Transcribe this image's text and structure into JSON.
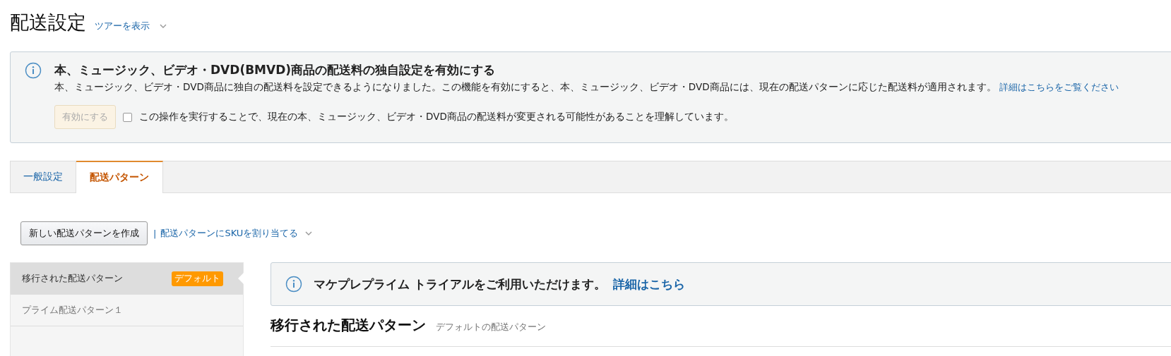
{
  "page": {
    "title": "配送設定",
    "tour_link": "ツアーを表示"
  },
  "notice": {
    "title": "本、ミュージック、ビデオ・DVD(BMVD)商品の配送料の独自設定を有効にする",
    "body": "本、ミュージック、ビデオ・DVD商品に独自の配送料を設定できるようになりました。この機能を有効にすると、本、ミュージック、ビデオ・DVD商品には、現在の配送パターンに応じた配送料が適用されます。",
    "link": "詳細はこちらをご覧ください",
    "button": {
      "label": "有効にする",
      "disabled": true
    },
    "consent": {
      "label": "この操作を実行することで、現在の本、ミュージック、ビデオ・DVD商品の配送料が変更される可能性があることを理解しています。",
      "checked": false
    }
  },
  "tabs": [
    {
      "label": "一般設定",
      "selected": false
    },
    {
      "label": "配送パターン",
      "selected": true
    }
  ],
  "toolbar": {
    "create_button": "新しい配送パターンを作成",
    "separator": "|",
    "assign_link": "配送パターンにSKUを割り当てる"
  },
  "patterns": [
    {
      "name": "移行された配送パターン",
      "badge": "デフォルト",
      "selected": true
    },
    {
      "name": "プライム配送パターン１",
      "selected": false
    }
  ],
  "detail": {
    "info": {
      "text": "マケプレプライム トライアルをご利用いただけます。",
      "link": "詳細はこちら"
    },
    "title": "移行された配送パターン",
    "subtitle": "デフォルトの配送パターン"
  }
}
